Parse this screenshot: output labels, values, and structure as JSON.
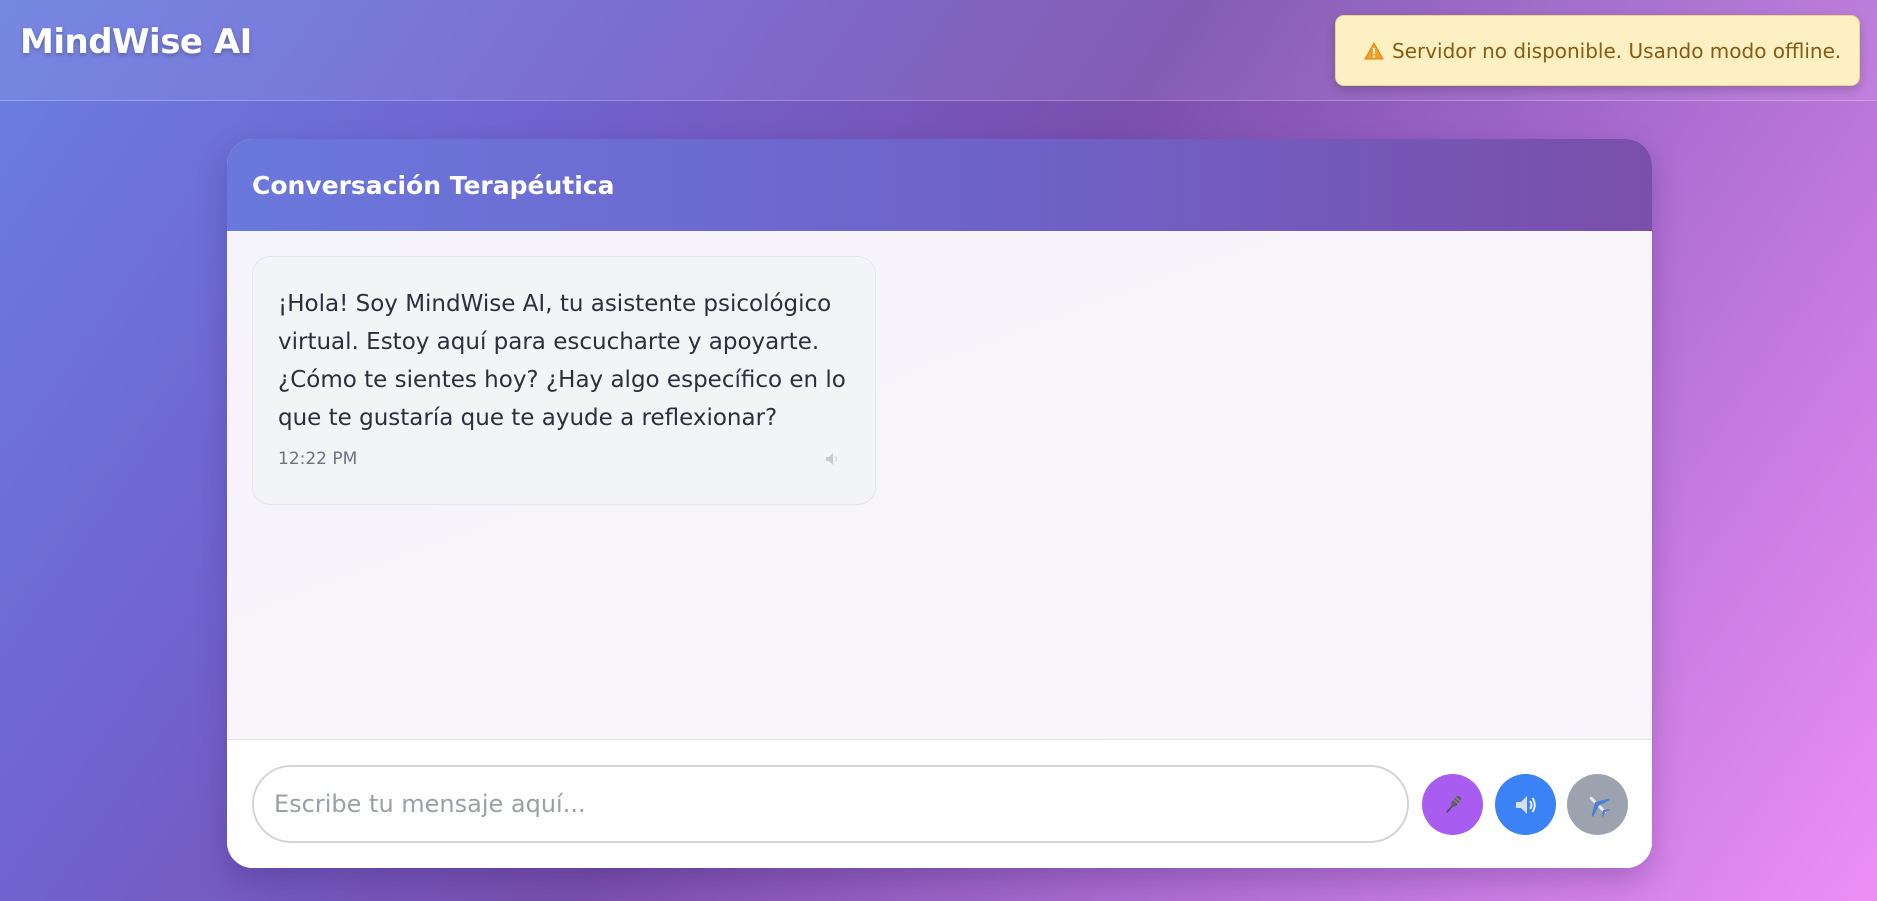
{
  "app": {
    "brand": "MindWise AI"
  },
  "alert": {
    "icon": "warning-icon",
    "text": "Servidor no disponible. Usando modo offline."
  },
  "chat": {
    "title": "Conversación Terapéutica",
    "messages": [
      {
        "sender": "assistant",
        "text": "¡Hola! Soy MindWise AI, tu asistente psicológico virtual. Estoy aquí para escucharte y apoyarte. ¿Cómo te sientes hoy? ¿Hay algo específico en lo que te gustaría que te ayude a reflexionar?",
        "time": "12:22 PM",
        "action_icon": "speaker-icon"
      }
    ]
  },
  "composer": {
    "placeholder": "Escribe tu mensaje aquí...",
    "value": "",
    "buttons": {
      "mic": "microphone-icon",
      "speaker": "speaker-icon",
      "send": "airplane-icon"
    }
  },
  "colors": {
    "mic": "#a95cf0",
    "speaker": "#3b82f6",
    "send": "#9ca3af",
    "alert_bg": "#fdf1c4",
    "alert_text": "#8a5a12"
  }
}
